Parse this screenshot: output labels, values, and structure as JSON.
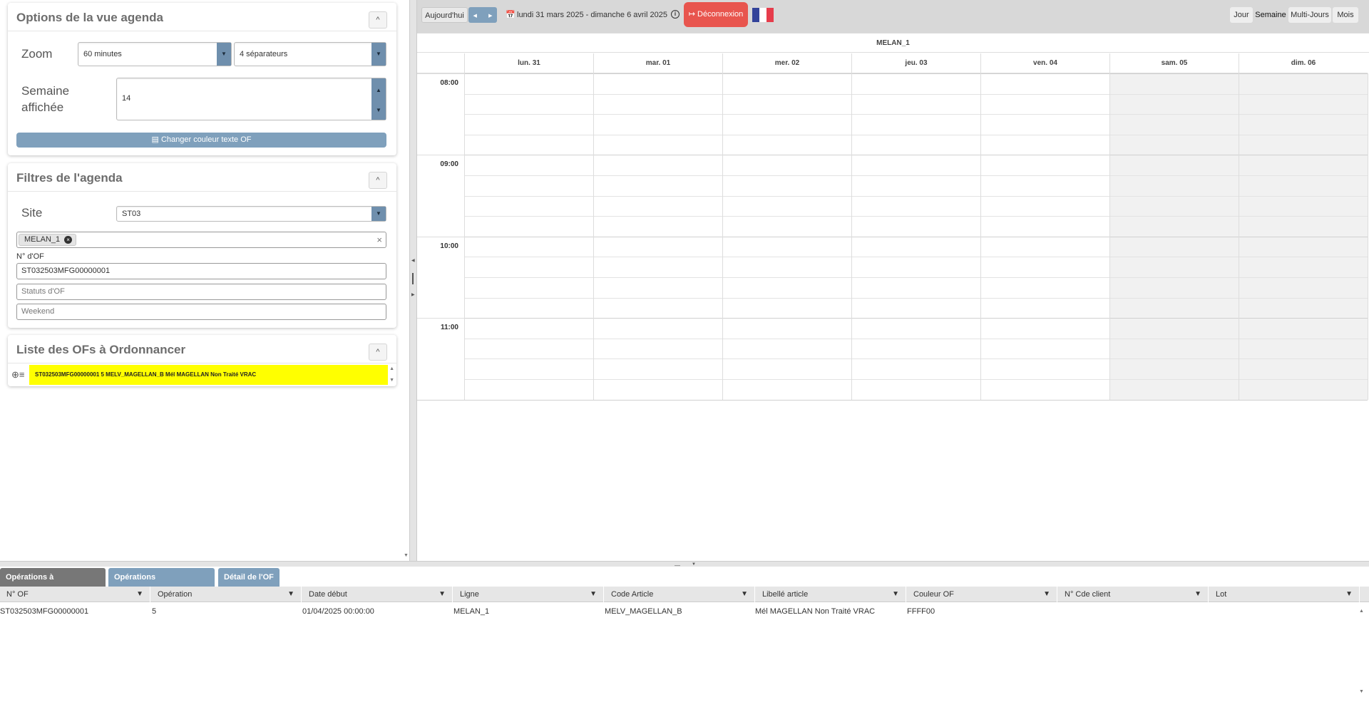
{
  "options": {
    "title": "Options de la vue agenda",
    "zoom_label": "Zoom",
    "zoom_value": "60 minutes",
    "separators_value": "4 séparateurs",
    "week_label": "Semaine affichée",
    "week_value": "14",
    "color_button": "Changer couleur texte OF"
  },
  "filters": {
    "title": "Filtres de l'agenda",
    "site_label": "Site",
    "site_value": "ST03",
    "resource_tag": "MELAN_1",
    "of_label": "N° d'OF",
    "of_value": "ST032503MFG00000001",
    "status_placeholder": "Statuts d'OF",
    "weekend_placeholder": "Weekend"
  },
  "of_list": {
    "title": "Liste des OFs à Ordonnancer",
    "items": [
      "ST032503MFG00000001 5 MELV_MAGELLAN_B Mél MAGELLAN Non Traité VRAC"
    ],
    "item_color": "#ffff00"
  },
  "toolbar": {
    "today": "Aujourd'hui",
    "range": "lundi 31 mars 2025 - dimanche 6 avril 2025",
    "logout": "Déconnexion",
    "views": [
      "Jour",
      "Semaine",
      "Multi-Jours",
      "Mois"
    ],
    "active_view": "Semaine"
  },
  "calendar": {
    "resource": "MELAN_1",
    "days": [
      "lun. 31",
      "mar. 01",
      "mer. 02",
      "jeu. 03",
      "ven. 04",
      "sam. 05",
      "dim. 06"
    ],
    "hours": [
      "08:00",
      "09:00",
      "10:00",
      "11:00"
    ]
  },
  "bottom": {
    "tabs": [
      "Opérations à ordonnancer",
      "Opérations ordonnancées",
      "Détail de l'OF"
    ],
    "columns": [
      "N° OF",
      "Opération",
      "Date début",
      "Ligne",
      "Code Article",
      "Libellé article",
      "Couleur OF",
      "N° Cde client",
      "Lot"
    ],
    "rows": [
      [
        "ST032503MFG00000001",
        "5",
        "01/04/2025 00:00:00",
        "MELAN_1",
        "MELV_MAGELLAN_B",
        "Mél MAGELLAN Non Traité VRAC",
        "FFFF00",
        "",
        ""
      ]
    ]
  },
  "colors": {
    "accent": "#6f8fad",
    "logout": "#e8554e",
    "tab_active": "#777777",
    "tab_inactive": "#7fa0bc"
  }
}
